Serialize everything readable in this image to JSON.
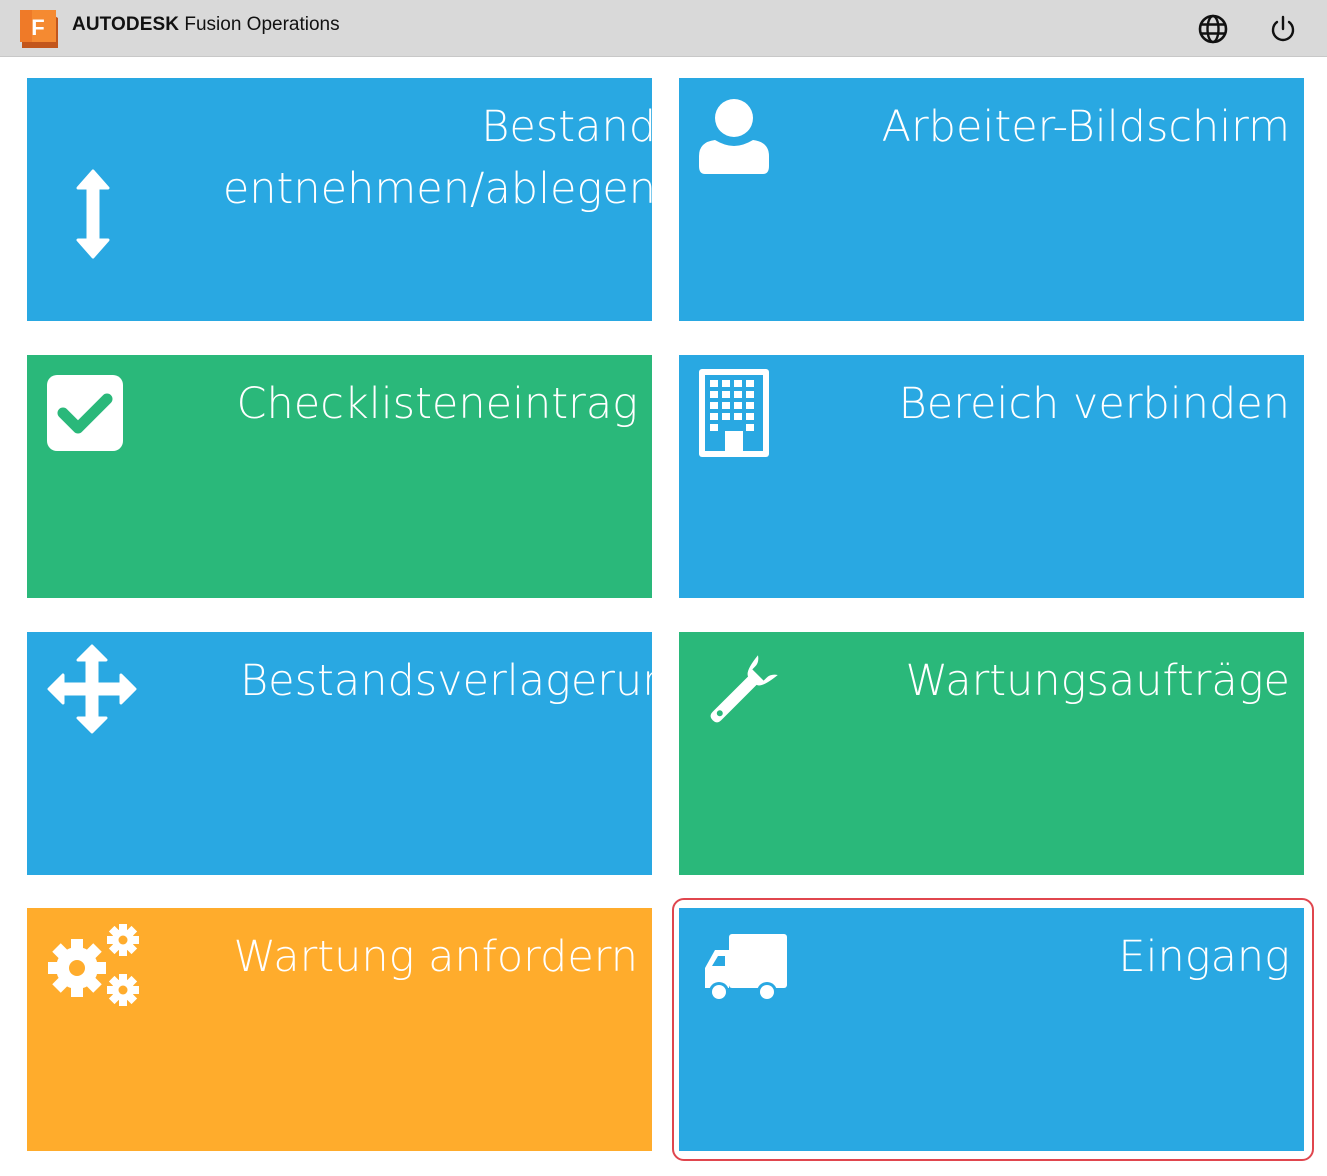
{
  "header": {
    "brand_name": "AUTODESK",
    "product_name": "Fusion Operations",
    "logo_letter": "F",
    "icons": {
      "logo": "fusion-logo-icon",
      "language": "globe-icon",
      "logout": "power-icon"
    }
  },
  "tiles": [
    {
      "label": "Bestand entnehmen/ablegen",
      "icon": "vertical-arrows-icon",
      "color": "#29a8e2"
    },
    {
      "label": "Arbeiter-Bildschirm",
      "icon": "user-icon",
      "color": "#29a8e2"
    },
    {
      "label": "Checklisteneintrag",
      "icon": "checkbox-icon",
      "color": "#2ab87a"
    },
    {
      "label": "Bereich verbinden",
      "icon": "building-icon",
      "color": "#29a8e2"
    },
    {
      "label": "Bestandsverlagerung",
      "icon": "move-arrows-icon",
      "color": "#29a8e2"
    },
    {
      "label": "Wartungsaufträge",
      "icon": "wrench-icon",
      "color": "#2ab87a"
    },
    {
      "label": "Wartung anfordern",
      "icon": "gears-icon",
      "color": "#ffac2c"
    },
    {
      "label": "Eingang",
      "icon": "truck-icon",
      "color": "#29a8e2",
      "highlighted": true
    }
  ],
  "colors": {
    "blue": "#29a8e2",
    "green": "#2ab87a",
    "orange": "#ffac2c",
    "highlight": "#e0464e",
    "header_bg": "#d9d9d9"
  }
}
